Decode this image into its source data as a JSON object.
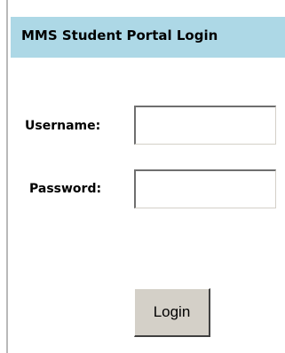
{
  "portal": {
    "title": "MMS Student Portal Login"
  },
  "form": {
    "username_label": "Username:",
    "username_value": "",
    "password_label": "Password:",
    "password_value": "",
    "login_label": "Login"
  },
  "colors": {
    "header_background": "#add8e6",
    "button_face": "#d4d0c8"
  }
}
